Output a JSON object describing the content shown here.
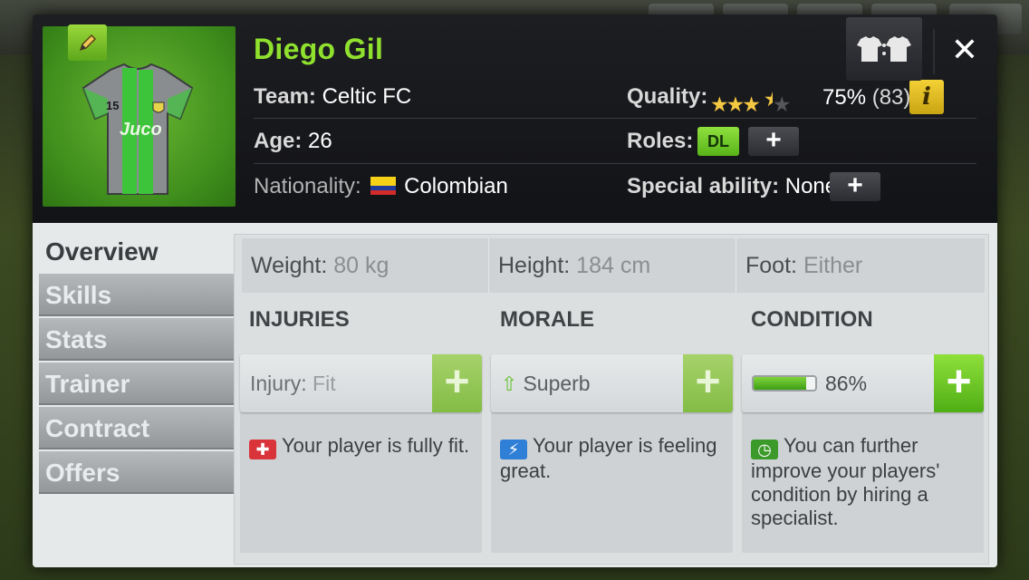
{
  "player": {
    "name": "Diego Gil",
    "shirt_number": "15",
    "sponsor": "Juco",
    "team_label": "Team:",
    "team_value": "Celtic FC",
    "age_label": "Age:",
    "age_value": "26",
    "nationality_label": "Nationality:",
    "nationality_value": "Colombian",
    "quality_label": "Quality:",
    "quality_stars": 3.5,
    "quality_pct": "75%",
    "quality_rating": "(83)",
    "roles_label": "Roles:",
    "role": "DL",
    "special_ability_label": "Special ability:",
    "special_ability_value": "None"
  },
  "header_buttons": {
    "kit_label": "T:T",
    "close_label": "✕",
    "info_label": "i"
  },
  "tabs": [
    {
      "label": "Overview",
      "active": true
    },
    {
      "label": "Skills"
    },
    {
      "label": "Stats"
    },
    {
      "label": "Trainer"
    },
    {
      "label": "Contract"
    },
    {
      "label": "Offers"
    }
  ],
  "physical": {
    "weight_label": "Weight:",
    "weight_value": "80 kg",
    "height_label": "Height:",
    "height_value": "184 cm",
    "foot_label": "Foot:",
    "foot_value": "Either"
  },
  "injuries": {
    "title": "INJURIES",
    "field_label": "Injury:",
    "field_value": "Fit",
    "description": "Your player is fully fit."
  },
  "morale": {
    "title": "MORALE",
    "field_value": "Superb",
    "description": "Your player is feeling great."
  },
  "condition": {
    "title": "CONDITION",
    "level": 0.86,
    "value_text": "86%",
    "description": "You can further improve your players' condition by hiring a specialist."
  },
  "plus_symbol": "+",
  "colors": {
    "name_green": "#8fe12e",
    "star_gold": "#f5c842",
    "info_yellow": "#f4d135",
    "action_green": "#4fae15"
  }
}
